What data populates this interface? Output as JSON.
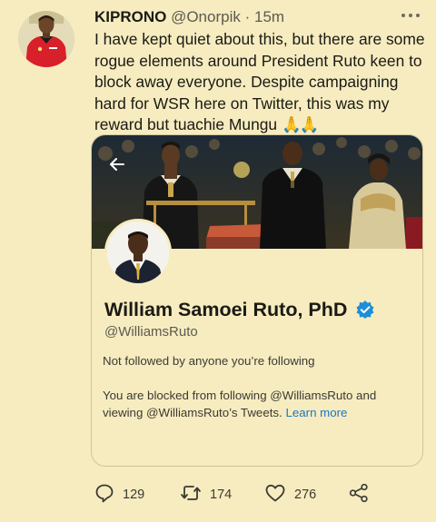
{
  "tweet": {
    "author_name": "KIPRONO",
    "author_handle": "@Onorpik",
    "separator": "·",
    "time": "15m",
    "text": "I have kept quiet about this, but there are some rogue elements around President Ruto keen to block away everyone. Despite campaigning hard for WSR here on Twitter, this was my reward but tuachie Mungu",
    "emoji": "🙏🙏"
  },
  "embedded_profile": {
    "name": "William Samoei Ruto, PhD",
    "handle": "@WilliamsRuto",
    "follow_context": "Not followed by anyone you’re following",
    "blocked_text": "You are blocked from following @WilliamsRuto and viewing @WilliamsRuto’s Tweets.",
    "learn_more": "Learn more"
  },
  "actions": {
    "replies": "129",
    "retweets": "174",
    "likes": "276"
  },
  "icons": {
    "more": "more-icon",
    "back": "back-arrow-icon",
    "verified": "verified-badge-icon",
    "reply": "reply-icon",
    "retweet": "retweet-icon",
    "like": "heart-icon",
    "share": "share-icon"
  },
  "colors": {
    "background": "#f6ecc0",
    "link": "#1d77c2",
    "verified": "#1d8fd6",
    "jersey": "#d8202a"
  }
}
